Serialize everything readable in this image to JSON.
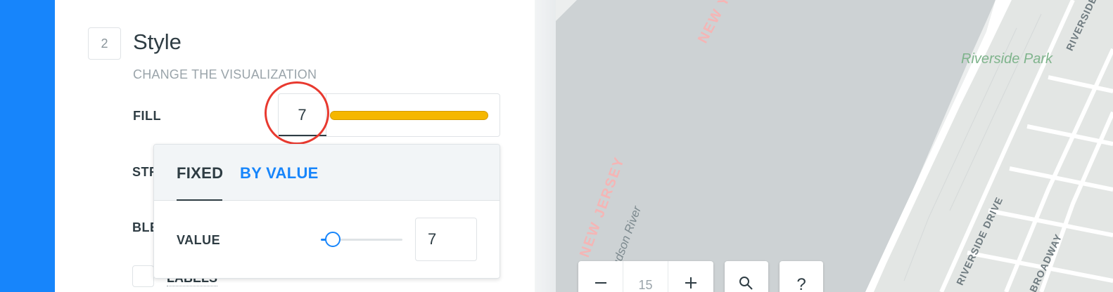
{
  "panel": {
    "step_number": "2",
    "title": "Style",
    "subtitle": "CHANGE THE VISUALIZATION",
    "fill_label": "FILL",
    "fill_value": "7",
    "stroke_label_partial": "STR",
    "blend_label_partial": "BLE",
    "labels_label": "LABELS"
  },
  "popover": {
    "tabs": [
      {
        "label": "FIXED",
        "active": true
      },
      {
        "label": "BY VALUE",
        "active": false
      }
    ],
    "value_label": "VALUE",
    "value": "7",
    "slider_fraction": 0.15
  },
  "map": {
    "labels": {
      "new_york": "NEW YORK",
      "new_jersey": "NEW JERSEY",
      "hudson_river": "Hudson River",
      "riverside_park": "Riverside Park",
      "riverside_drive": "RIVERSIDE DRIVE",
      "riverside_top": "RIVERSIDE",
      "broadway": "BROADWAY"
    },
    "zoom_out_icon": "minus-icon",
    "zoom_level": "15",
    "zoom_in_icon": "plus-icon",
    "search_icon": "search-icon",
    "help_label": "?"
  },
  "colors": {
    "rail": "#1785fb",
    "accent": "#1785fb",
    "fill_bar": "#f5b700",
    "highlight": "#e8392f",
    "water": "#cdd2d4",
    "land": "#eceeee",
    "park": "#e3e6e4"
  }
}
